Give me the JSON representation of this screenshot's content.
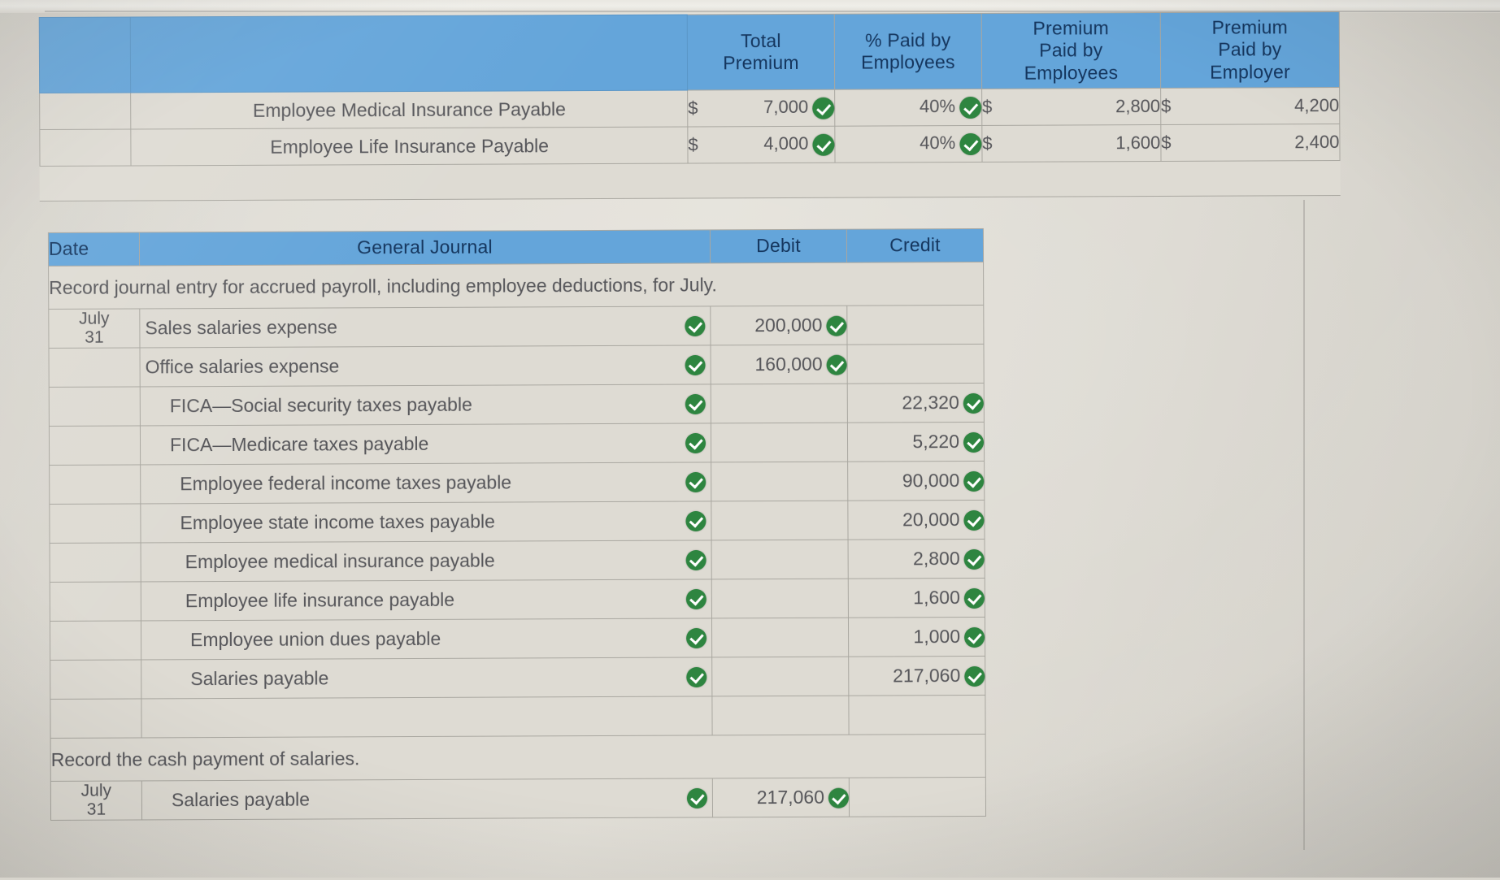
{
  "premium_table": {
    "headers": [
      "",
      "",
      "Total\nPremium",
      "% Paid by\nEmployees",
      "Premium\nPaid by\nEmployees",
      "Premium\nPaid by\nEmployer"
    ],
    "header_total_premium_l1": "Total",
    "header_total_premium_l2": "Premium",
    "header_pct_l1": "% Paid by",
    "header_pct_l2": "Employees",
    "header_prem_emp_l1": "Premium",
    "header_prem_emp_l2": "Paid by",
    "header_prem_emp_l3": "Employees",
    "header_prem_empr_l1": "Premium",
    "header_prem_empr_l2": "Paid by",
    "header_prem_empr_l3": "Employer",
    "rows": [
      {
        "label": "Employee Medical Insurance Payable",
        "total_premium_currency": "$",
        "total_premium": "7,000",
        "total_premium_checked": true,
        "pct_paid_by_employees": "40%",
        "pct_checked": true,
        "premium_paid_by_employees_currency": "$",
        "premium_paid_by_employees": "2,800",
        "premium_paid_by_employer_currency": "$",
        "premium_paid_by_employer": "4,200"
      },
      {
        "label": "Employee Life Insurance Payable",
        "total_premium_currency": "$",
        "total_premium": "4,000",
        "total_premium_checked": true,
        "pct_paid_by_employees": "40%",
        "pct_checked": true,
        "premium_paid_by_employees_currency": "$",
        "premium_paid_by_employees": "1,600",
        "premium_paid_by_employer_currency": "$",
        "premium_paid_by_employer": "2,400"
      }
    ]
  },
  "journal": {
    "headers": {
      "date": "Date",
      "general_journal": "General Journal",
      "debit": "Debit",
      "credit": "Credit"
    },
    "note_1": "Record journal entry for accrued payroll, including employee deductions, for July.",
    "note_2": "Record the cash payment of salaries.",
    "entry_1": [
      {
        "date_line1": "July",
        "date_line2": "31",
        "account": "Sales salaries expense",
        "indent": 0,
        "account_checked": true,
        "debit": "200,000",
        "debit_checked": true,
        "credit": "",
        "credit_checked": false
      },
      {
        "date_line1": "",
        "date_line2": "",
        "account": "Office salaries expense",
        "indent": 0,
        "account_checked": true,
        "debit": "160,000",
        "debit_checked": true,
        "credit": "",
        "credit_checked": false
      },
      {
        "date_line1": "",
        "date_line2": "",
        "account": "FICA—Social security taxes payable",
        "indent": 1,
        "account_checked": true,
        "debit": "",
        "debit_checked": false,
        "credit": "22,320",
        "credit_checked": true
      },
      {
        "date_line1": "",
        "date_line2": "",
        "account": "FICA—Medicare taxes payable",
        "indent": 1,
        "account_checked": true,
        "debit": "",
        "debit_checked": false,
        "credit": "5,220",
        "credit_checked": true
      },
      {
        "date_line1": "",
        "date_line2": "",
        "account": "Employee federal income taxes payable",
        "indent": 2,
        "account_checked": true,
        "debit": "",
        "debit_checked": false,
        "credit": "90,000",
        "credit_checked": true
      },
      {
        "date_line1": "",
        "date_line2": "",
        "account": "Employee state income taxes payable",
        "indent": 2,
        "account_checked": true,
        "debit": "",
        "debit_checked": false,
        "credit": "20,000",
        "credit_checked": true
      },
      {
        "date_line1": "",
        "date_line2": "",
        "account": "Employee medical insurance payable",
        "indent": 3,
        "account_checked": true,
        "debit": "",
        "debit_checked": false,
        "credit": "2,800",
        "credit_checked": true
      },
      {
        "date_line1": "",
        "date_line2": "",
        "account": "Employee life insurance payable",
        "indent": 3,
        "account_checked": true,
        "debit": "",
        "debit_checked": false,
        "credit": "1,600",
        "credit_checked": true
      },
      {
        "date_line1": "",
        "date_line2": "",
        "account": "Employee union dues payable",
        "indent": 4,
        "account_checked": true,
        "debit": "",
        "debit_checked": false,
        "credit": "1,000",
        "credit_checked": true
      },
      {
        "date_line1": "",
        "date_line2": "",
        "account": "Salaries payable",
        "indent": 4,
        "account_checked": true,
        "debit": "",
        "debit_checked": false,
        "credit": "217,060",
        "credit_checked": true
      },
      {
        "date_line1": "",
        "date_line2": "",
        "account": "",
        "indent": 0,
        "account_checked": false,
        "debit": "",
        "debit_checked": false,
        "credit": "",
        "credit_checked": false
      }
    ],
    "entry_2": [
      {
        "date_line1": "July",
        "date_line2": "31",
        "account": "Salaries payable",
        "indent": 1,
        "account_checked": true,
        "debit": "217,060",
        "debit_checked": true,
        "credit": "",
        "credit_checked": false
      }
    ]
  },
  "colors": {
    "header_blue": "#64a5da",
    "header_text": "#15365e",
    "cell_bg": "#dedbd3",
    "grid_line": "#a9a7a0",
    "check_green": "#2e8540",
    "body_text": "#56565a"
  }
}
